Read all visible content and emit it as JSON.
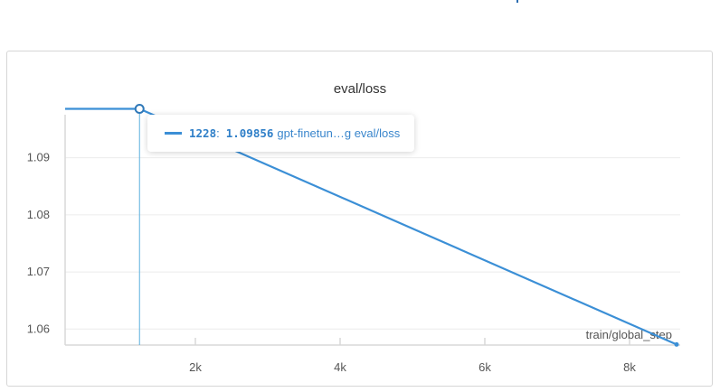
{
  "chart_data": {
    "type": "line",
    "title": "eval/loss",
    "xlabel": "train/global_step",
    "ylabel": "",
    "xlim": [
      200,
      8700
    ],
    "ylim": [
      1.0572,
      1.0999
    ],
    "x_ticks": [
      2000,
      4000,
      6000,
      8000
    ],
    "x_tick_labels": [
      "2k",
      "4k",
      "6k",
      "8k"
    ],
    "y_ticks": [
      1.06,
      1.07,
      1.08,
      1.09
    ],
    "y_tick_labels": [
      "1.06",
      "1.07",
      "1.08",
      "1.09"
    ],
    "grid": true,
    "legend": "none",
    "series": [
      {
        "name": "gpt-finetun…g eval/loss",
        "color": "#3b8fd6",
        "x": [
          200,
          1228,
          8650
        ],
        "y": [
          1.09856,
          1.09856,
          1.0573
        ]
      }
    ],
    "hover": {
      "x": 1228,
      "y": 1.09856,
      "step_label": "1228",
      "value_label": "1.09856",
      "series_label": "gpt-finetun…g eval/loss"
    }
  }
}
